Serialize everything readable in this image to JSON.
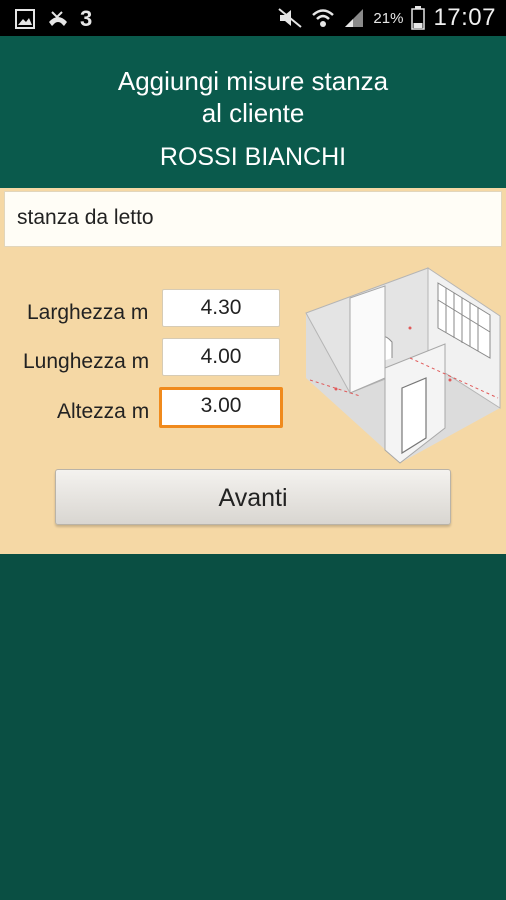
{
  "status_bar": {
    "carrier": "3",
    "battery_percent": "21%",
    "time": "17:07",
    "icons": [
      "gallery-icon",
      "missed-call-icon",
      "mute-icon",
      "wifi-icon",
      "signal-icon",
      "battery-icon"
    ]
  },
  "header": {
    "title_line1": "Aggiungi misure stanza",
    "title_line2": "al cliente",
    "client_name": "ROSSI BIANCHI"
  },
  "form": {
    "room_name": "stanza da letto",
    "width_label": "Larghezza m",
    "width_value": "4.30",
    "length_label": "Lunghezza m",
    "length_value": "4.00",
    "height_label": "Altezza m",
    "height_value": "3.00",
    "submit_label": "Avanti"
  },
  "colors": {
    "primary": "#0a5a4c",
    "panel": "#f5d8a5",
    "focus": "#f08a1c"
  }
}
